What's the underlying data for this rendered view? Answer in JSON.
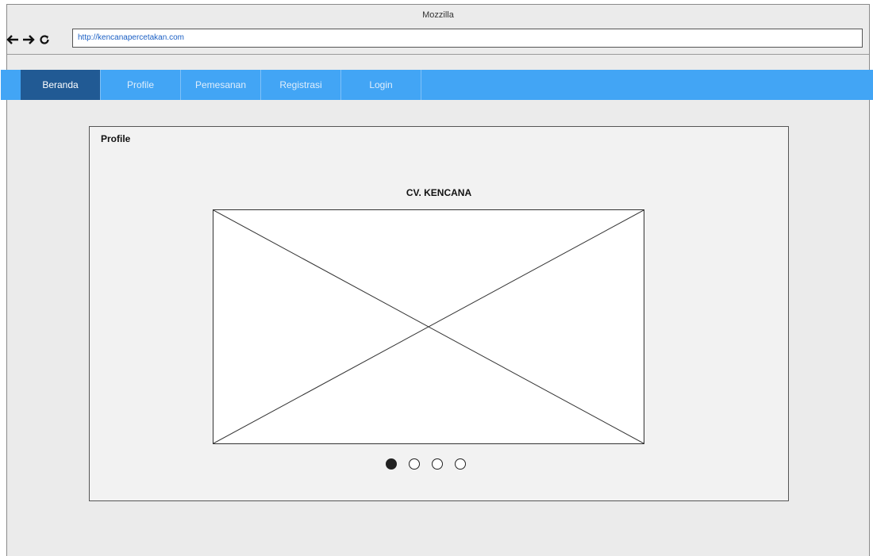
{
  "browser": {
    "title": "Mozzilla",
    "url": "http://kencanapercetakan.com",
    "icons": [
      "back-arrow-icon",
      "forward-arrow-icon",
      "reload-icon"
    ]
  },
  "menu": {
    "items": [
      {
        "label": "Beranda",
        "active": true
      },
      {
        "label": "Profile",
        "active": false
      },
      {
        "label": "Pemesanan",
        "active": false
      },
      {
        "label": "Registrasi",
        "active": false
      },
      {
        "label": "Login",
        "active": false
      }
    ],
    "bar_color": "#42a5f5",
    "active_color": "#215a94"
  },
  "panel": {
    "title": "Profile",
    "heading": "CV. KENCANA",
    "image_placeholder": "image-placeholder",
    "carousel": {
      "count": 4,
      "active_index": 0
    }
  }
}
